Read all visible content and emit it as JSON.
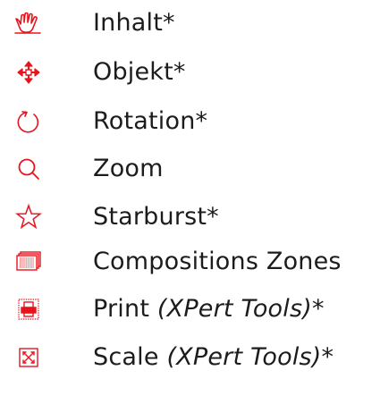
{
  "colors": {
    "icon": "#e8141c",
    "text": "#1c1c1c",
    "background": "#ffffff"
  },
  "tools": [
    {
      "label": "Inhalt*",
      "note": "",
      "icon": "hand-icon"
    },
    {
      "label": "Objekt*",
      "note": "",
      "icon": "move-arrows-icon"
    },
    {
      "label": "Rotation*",
      "note": "",
      "icon": "rotate-icon"
    },
    {
      "label": "Zoom",
      "note": "",
      "icon": "magnifier-icon"
    },
    {
      "label": "Starburst*",
      "note": "",
      "icon": "star-icon"
    },
    {
      "label": "Compositions Zones",
      "note": "",
      "icon": "composition-zones-icon"
    },
    {
      "label": "Print ",
      "note": "(XPert Tools)*",
      "icon": "print-icon"
    },
    {
      "label": "Scale ",
      "note": "(XPert Tools)*",
      "icon": "scale-icon"
    }
  ]
}
